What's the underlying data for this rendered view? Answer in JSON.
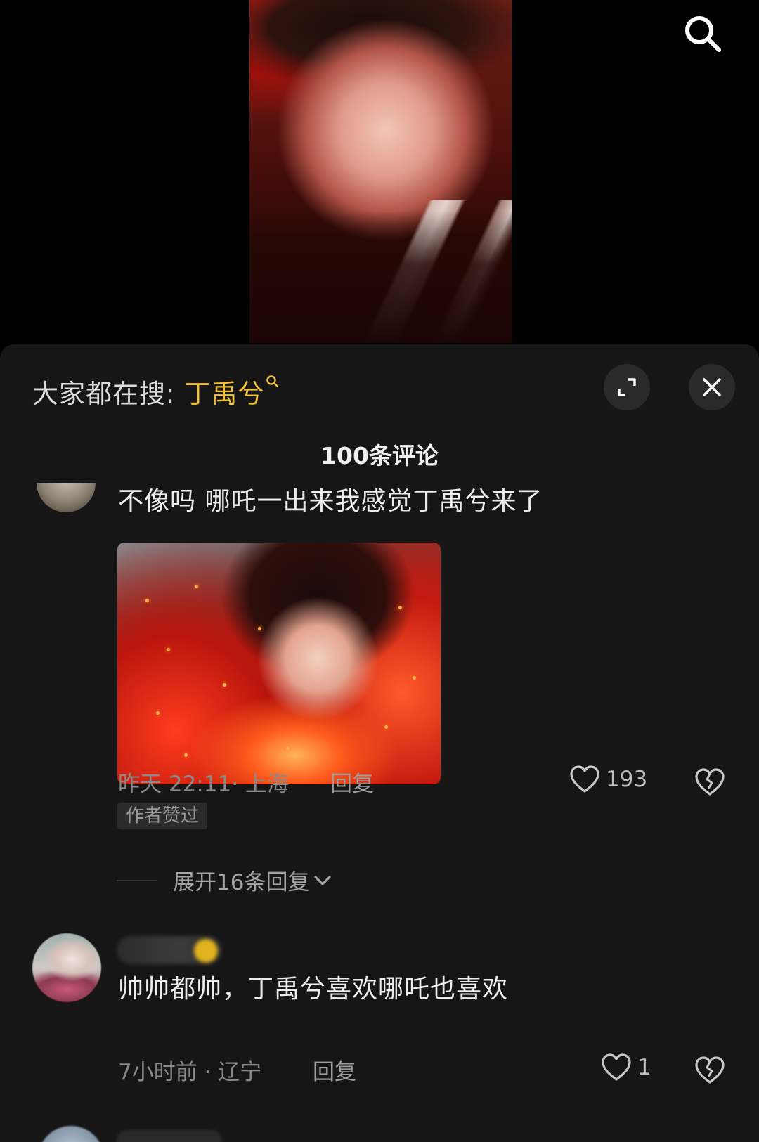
{
  "video": {
    "search_icon": "search-icon"
  },
  "panel": {
    "trending_prefix": "大家都在搜: ",
    "trending_keyword": "丁禹兮",
    "comment_count": "100条评论"
  },
  "comments": [
    {
      "text": "不像吗 哪吒一出来我感觉丁禹兮来了",
      "meta": "昨天 22:11· 上海",
      "reply_label": "回复",
      "likes": "193",
      "badge": "作者赞过",
      "expand_label": "展开16条回复"
    },
    {
      "text": "帅帅都帅，丁禹兮喜欢哪吒也喜欢",
      "meta": "7小时前 · 辽宁",
      "reply_label": "回复",
      "likes": "1"
    }
  ],
  "colors": {
    "keyword": "#f2c23c",
    "panel_bg": "#161616",
    "background": "#000000"
  }
}
